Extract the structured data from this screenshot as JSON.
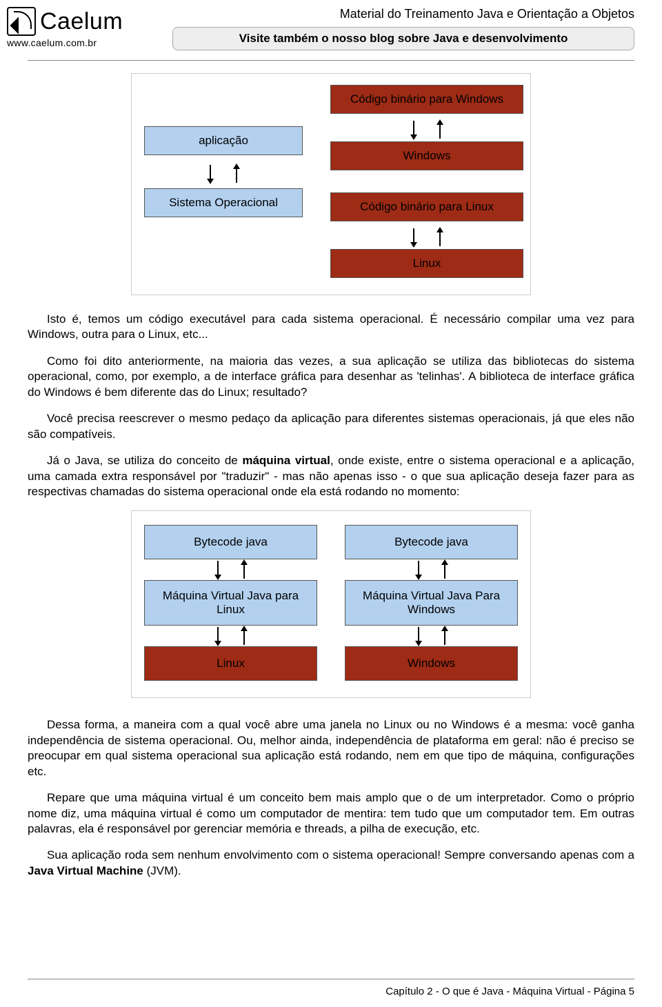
{
  "header": {
    "logo_text": "Caelum",
    "logo_url": "www.caelum.com.br",
    "material_title": "Material do Treinamento Java e Orientação a Objetos",
    "banner": "Visite também o nosso blog sobre Java e desenvolvimento"
  },
  "diagram1": {
    "left_app": "aplicação",
    "left_so": "Sistema Operacional",
    "right_bin_win": "Código binário para Windows",
    "right_win": "Windows",
    "right_bin_linux": "Código binário para Linux",
    "right_linux": "Linux"
  },
  "paragraphs": {
    "p1": "Isto é, temos um código executável para cada sistema operacional. É necessário compilar uma vez para Windows, outra para o Linux, etc...",
    "p2": "Como foi dito anteriormente, na maioria das vezes, a sua aplicação se utiliza das bibliotecas do sistema operacional, como, por exemplo, a de interface gráfica para desenhar as 'telinhas'. A biblioteca de interface gráfica do Windows é bem diferente das do Linux; resultado?",
    "p3": "Você precisa reescrever o mesmo pedaço da aplicação para diferentes sistemas operacionais, já que eles não são compatíveis.",
    "p4a": "Já o Java, se utiliza do conceito de ",
    "p4b": "máquina virtual",
    "p4c": ", onde existe, entre o sistema operacional e a aplicação, uma camada extra responsável por \"traduzir\" - mas não apenas isso - o que sua aplicação deseja fazer para as respectivas chamadas do sistema operacional onde ela está rodando no momento:",
    "p5": "Dessa forma, a maneira com a qual você abre uma janela no Linux ou no Windows é a mesma: você ganha independência de sistema operacional. Ou, melhor ainda, independência de plataforma em geral: não é preciso se preocupar em qual sistema operacional sua aplicação está rodando, nem em que tipo de máquina, configurações etc.",
    "p6": "Repare que uma máquina virtual é um conceito bem mais amplo que o de um interpretador. Como o próprio nome diz, uma máquina virtual é como um computador de mentira: tem tudo que um computador tem. Em outras palavras, ela é responsável por gerenciar memória e threads, a pilha de execução, etc.",
    "p7a": "Sua aplicação roda sem nenhum envolvimento com o sistema operacional! Sempre conversando apenas com a ",
    "p7b": "Java Virtual Machine",
    "p7c": " (JVM)."
  },
  "diagram2": {
    "bytecode": "Bytecode java",
    "jvm_linux": "Máquina Virtual Java para Linux",
    "jvm_win": "Máquina Virtual Java Para Windows",
    "linux": "Linux",
    "windows": "Windows"
  },
  "footer": "Capítulo 2 - O que é Java -  Máquina Virtual - Página 5"
}
